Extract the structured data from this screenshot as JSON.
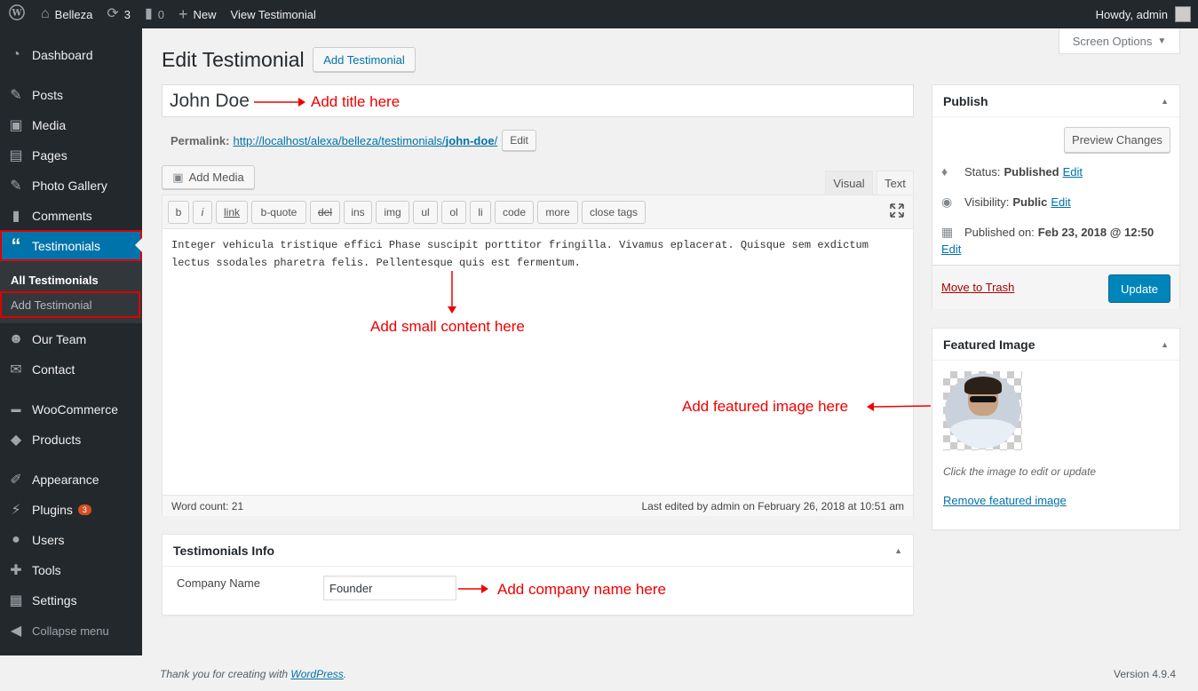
{
  "adminbar": {
    "site_name": "Belleza",
    "updates_count": "3",
    "comments_count": "0",
    "new_label": "New",
    "view_label": "View Testimonial",
    "howdy": "Howdy, admin"
  },
  "sidebar": {
    "items": [
      {
        "label": "Dashboard",
        "icon": "dashboard-icon"
      },
      {
        "label": "Posts",
        "icon": "pin-icon"
      },
      {
        "label": "Media",
        "icon": "media-icon"
      },
      {
        "label": "Pages",
        "icon": "pages-icon"
      },
      {
        "label": "Photo Gallery",
        "icon": "pin-icon"
      },
      {
        "label": "Comments",
        "icon": "comment-icon"
      },
      {
        "label": "Testimonials",
        "icon": "quote-icon"
      },
      {
        "label": "Our Team",
        "icon": "groups-icon"
      },
      {
        "label": "Contact",
        "icon": "mail-icon"
      },
      {
        "label": "WooCommerce",
        "icon": "woo-icon"
      },
      {
        "label": "Products",
        "icon": "box-icon"
      },
      {
        "label": "Appearance",
        "icon": "brush-icon"
      },
      {
        "label": "Plugins",
        "icon": "plug-icon",
        "badge": "3"
      },
      {
        "label": "Users",
        "icon": "user-icon"
      },
      {
        "label": "Tools",
        "icon": "wrench-icon"
      },
      {
        "label": "Settings",
        "icon": "settings-icon"
      },
      {
        "label": "Collapse menu",
        "icon": "collapse-icon"
      }
    ],
    "submenu": [
      "All Testimonials",
      "Add Testimonial"
    ]
  },
  "screen_options": "Screen Options",
  "page": {
    "title": "Edit Testimonial",
    "add_new": "Add Testimonial",
    "post_title": "John Doe",
    "permalink_label": "Permalink:",
    "permalink_base": "http://localhost/alexa/belleza/testimonials/",
    "permalink_slug": "john-doe",
    "permalink_tail": "/",
    "edit_btn": "Edit",
    "add_media": "Add Media",
    "tab_visual": "Visual",
    "tab_text": "Text",
    "content": "Integer vehicula tristique effici Phase suscipit porttitor fringilla. Vivamus eplacerat. Quisque sem exdictum  lectus ssodales pharetra felis. Pellentesque quis est fermentum.",
    "word_count": "Word count: 21",
    "last_edited": "Last edited by admin on February 26, 2018 at 10:51 am"
  },
  "quicktags": [
    "b",
    "i",
    "link",
    "b-quote",
    "del",
    "ins",
    "img",
    "ul",
    "ol",
    "li",
    "code",
    "more",
    "close tags"
  ],
  "publish": {
    "title": "Publish",
    "preview": "Preview Changes",
    "status_label": "Status:",
    "status_value": "Published",
    "visibility_label": "Visibility:",
    "visibility_value": "Public",
    "published_label": "Published on:",
    "published_value": "Feb 23, 2018 @ 12:50",
    "edit": "Edit",
    "trash": "Move to Trash",
    "update": "Update"
  },
  "featured": {
    "title": "Featured Image",
    "hint": "Click the image to edit or update",
    "remove": "Remove featured image"
  },
  "info": {
    "title": "Testimonials Info",
    "company_label": "Company Name",
    "company_value": "Founder"
  },
  "annotations": {
    "title": "Add title here",
    "content": "Add small content here",
    "featured": "Add featured image here",
    "company": "Add company name here"
  },
  "footer": {
    "thanks_prefix": "Thank you for creating with ",
    "wp_link": "WordPress",
    "thanks_suffix": ".",
    "version": "Version 4.9.4"
  }
}
